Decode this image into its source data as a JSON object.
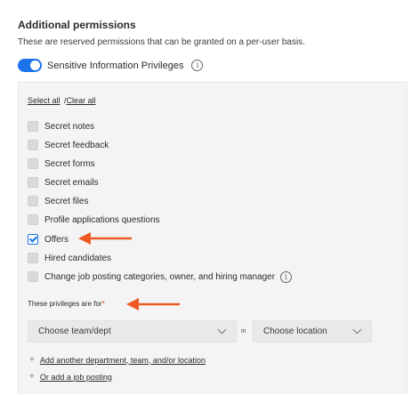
{
  "section": {
    "title": "Additional permissions",
    "subtitle": "These are reserved permissions that can be granted on a per-user basis."
  },
  "toggle": {
    "label": "Sensitive Information Privileges",
    "on": true,
    "info_icon": "i"
  },
  "links": {
    "select_all": "Select all",
    "separator": "/",
    "clear_all": "Clear all"
  },
  "permissions": [
    {
      "label": "Secret notes",
      "checked": false
    },
    {
      "label": "Secret feedback",
      "checked": false
    },
    {
      "label": "Secret forms",
      "checked": false
    },
    {
      "label": "Secret emails",
      "checked": false
    },
    {
      "label": "Secret files",
      "checked": false
    },
    {
      "label": "Profile applications questions",
      "checked": false
    },
    {
      "label": "Offers",
      "checked": true
    },
    {
      "label": "Hired candidates",
      "checked": false
    },
    {
      "label": "Change job posting categories, owner, and hiring manager",
      "checked": false
    }
  ],
  "privileges_for": {
    "label": "These privileges are for",
    "required_mark": "*",
    "team_select": "Choose team/dept",
    "in_label": "in",
    "location_select": "Choose location",
    "add_department": "Add another department, team, and/or location",
    "add_job_posting": "Or add a job posting",
    "plus": "+"
  },
  "colors": {
    "accent": "#1a73e8",
    "annotation_arrow": "#ec5a24",
    "required": "#e0321f"
  }
}
